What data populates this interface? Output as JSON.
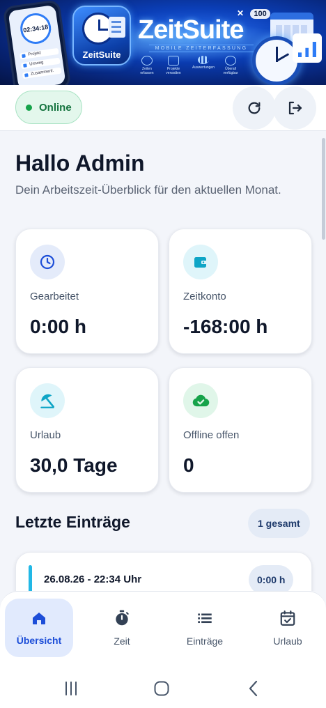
{
  "banner": {
    "phone_time": "02:34:18",
    "phone_rows": [
      "Projekt",
      "Umweg",
      "Zusammenf."
    ],
    "app_icon_label": "ZeitSuite",
    "brand_title": "ZeitSuite",
    "brand_subtitle": "MOBILE ZEITERFASSUNG",
    "features": [
      {
        "label": "Zeiten erfassen",
        "icon": "clock-icon"
      },
      {
        "label": "Projekte verwalten",
        "icon": "clipboard-icon"
      },
      {
        "label": "Auswertungen",
        "icon": "bar-chart-icon"
      },
      {
        "label": "Überall verfügbar",
        "icon": "cloud-icon"
      }
    ],
    "battery": "100"
  },
  "topbar": {
    "status_label": "Online",
    "status_color": "#16a34a",
    "refresh_icon": "refresh-icon",
    "logout_icon": "logout-icon"
  },
  "main": {
    "greeting": "Hallo Admin",
    "subtitle": "Dein Arbeitszeit-Überblick für den aktuellen Monat.",
    "cards": [
      {
        "label": "Gearbeitet",
        "value": "0:00 h",
        "icon": "clock-icon",
        "icon_color": "#1d4ed8",
        "bg": "#e4ebfa"
      },
      {
        "label": "Zeitkonto",
        "value": "-168:00 h",
        "icon": "wallet-icon",
        "icon_color": "#0ea5c6",
        "bg": "#dff5fa"
      },
      {
        "label": "Urlaub",
        "value": "30,0 Tage",
        "icon": "umbrella-icon",
        "icon_color": "#0ea5c6",
        "bg": "#dff5fa"
      },
      {
        "label": "Offline offen",
        "value": "0",
        "icon": "cloud-check-icon",
        "icon_color": "#16a34a",
        "bg": "#e0f6e9"
      }
    ],
    "recent_title": "Letzte Einträge",
    "recent_count": "1 gesamt",
    "entries": [
      {
        "date": "26.08.26 - 22:34 Uhr",
        "duration": "0:00 h"
      }
    ]
  },
  "nav": {
    "items": [
      {
        "label": "Übersicht",
        "icon": "home-icon",
        "active": true
      },
      {
        "label": "Zeit",
        "icon": "stopwatch-icon",
        "active": false
      },
      {
        "label": "Einträge",
        "icon": "list-icon",
        "active": false
      },
      {
        "label": "Urlaub",
        "icon": "calendar-check-icon",
        "active": false
      }
    ]
  },
  "system_nav": {
    "recents_icon": "recents-icon",
    "home_icon": "system-home-icon",
    "back_icon": "back-icon"
  }
}
